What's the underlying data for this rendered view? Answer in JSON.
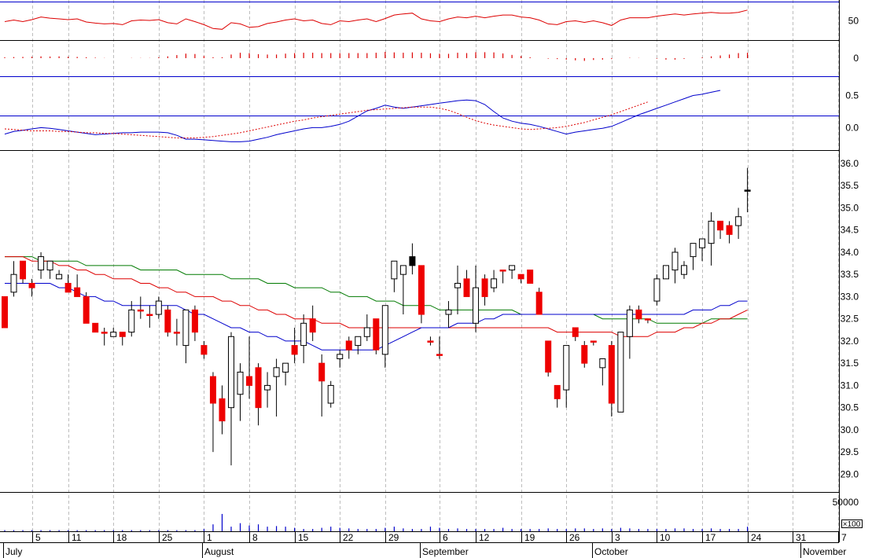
{
  "chart_data": {
    "type": "candlestick",
    "x_tick_labels": [
      {
        "label": "5",
        "date": "2012-07-05"
      },
      {
        "label": "11",
        "date": "2012-07-11"
      },
      {
        "label": "18",
        "date": "2012-07-18"
      },
      {
        "label": "25",
        "date": "2012-07-25"
      },
      {
        "label": "1",
        "date": "2012-08-01"
      },
      {
        "label": "8",
        "date": "2012-08-08"
      },
      {
        "label": "15",
        "date": "2012-08-15"
      },
      {
        "label": "22",
        "date": "2012-08-22"
      },
      {
        "label": "29",
        "date": "2012-08-29"
      },
      {
        "label": "6",
        "date": "2012-09-06"
      },
      {
        "label": "12",
        "date": "2012-09-12"
      },
      {
        "label": "19",
        "date": "2012-09-19"
      },
      {
        "label": "26",
        "date": "2012-09-26"
      },
      {
        "label": "3",
        "date": "2012-10-03"
      },
      {
        "label": "10",
        "date": "2012-10-10"
      },
      {
        "label": "17",
        "date": "2012-10-17"
      },
      {
        "label": "24",
        "date": "2012-10-24"
      },
      {
        "label": "31",
        "date": "2012-10-31"
      },
      {
        "label": "7",
        "date": "2012-11-07"
      }
    ],
    "month_labels": [
      "July",
      "August",
      "September",
      "October",
      "November"
    ],
    "panels": {
      "rsi": {
        "ticks": [
          50
        ],
        "ylim": [
          0,
          100
        ]
      },
      "macd_hist": {
        "ticks": [
          0
        ],
        "ylim": [
          -1,
          1
        ]
      },
      "macd": {
        "ticks": [
          0.5,
          0.0
        ],
        "ylim": [
          -0.35,
          0.8
        ]
      },
      "price": {
        "ticks": [
          36.0,
          35.5,
          35.0,
          34.5,
          34.0,
          33.5,
          33.0,
          32.5,
          32.0,
          31.5,
          31.0,
          30.5,
          30.0,
          29.5,
          29.0
        ],
        "ylim": [
          28.6,
          36.3
        ]
      },
      "volume": {
        "ticks": [
          50000
        ],
        "unit": "×100",
        "ylim": [
          0,
          68000
        ]
      }
    },
    "ohlc": [
      [
        33.0,
        33.0,
        32.3,
        32.3
      ],
      [
        33.1,
        33.8,
        33.0,
        33.5
      ],
      [
        33.8,
        33.8,
        33.3,
        33.4
      ],
      [
        33.3,
        33.4,
        33.0,
        33.2
      ],
      [
        33.6,
        34.0,
        33.4,
        33.9
      ],
      [
        33.6,
        33.8,
        33.4,
        33.8
      ],
      [
        33.4,
        33.6,
        33.4,
        33.5
      ],
      [
        33.3,
        33.5,
        33.1,
        33.1
      ],
      [
        33.2,
        33.5,
        33.0,
        33.0
      ],
      [
        33.0,
        33.1,
        32.4,
        32.4
      ],
      [
        32.4,
        32.4,
        32.2,
        32.2
      ],
      [
        32.2,
        32.3,
        31.9,
        32.2
      ],
      [
        32.1,
        32.3,
        32.1,
        32.2
      ],
      [
        32.2,
        32.2,
        31.9,
        32.1
      ],
      [
        32.2,
        32.9,
        32.1,
        32.7
      ],
      [
        32.7,
        33.0,
        32.5,
        32.7
      ],
      [
        32.6,
        32.8,
        32.3,
        32.6
      ],
      [
        32.6,
        33.0,
        32.5,
        32.9
      ],
      [
        32.7,
        32.8,
        32.1,
        32.2
      ],
      [
        32.2,
        32.5,
        31.9,
        32.2
      ],
      [
        31.9,
        32.7,
        31.5,
        32.7
      ],
      [
        32.7,
        32.8,
        32.0,
        32.2
      ],
      [
        31.9,
        32.0,
        31.6,
        31.7
      ],
      [
        31.2,
        31.3,
        29.5,
        30.6
      ],
      [
        30.7,
        31.0,
        29.9,
        30.2
      ],
      [
        30.5,
        32.2,
        29.2,
        32.1
      ],
      [
        30.8,
        31.5,
        30.2,
        31.3
      ],
      [
        31.2,
        32.1,
        30.7,
        31.0
      ],
      [
        31.4,
        31.5,
        30.1,
        30.5
      ],
      [
        30.9,
        31.3,
        30.5,
        31.0
      ],
      [
        31.2,
        31.6,
        30.3,
        31.4
      ],
      [
        31.3,
        31.5,
        31.0,
        31.5
      ],
      [
        31.9,
        32.3,
        31.5,
        31.7
      ],
      [
        31.9,
        32.6,
        31.5,
        32.4
      ],
      [
        32.5,
        32.8,
        32.0,
        32.2
      ],
      [
        31.5,
        31.7,
        30.3,
        31.1
      ],
      [
        30.6,
        31.1,
        30.5,
        31.0
      ],
      [
        31.6,
        31.8,
        31.4,
        31.7
      ],
      [
        32.0,
        32.1,
        31.6,
        31.8
      ],
      [
        31.9,
        32.1,
        31.7,
        32.1
      ],
      [
        32.1,
        32.6,
        32.0,
        32.3
      ],
      [
        32.5,
        32.5,
        31.7,
        31.8
      ],
      [
        31.7,
        32.6,
        31.4,
        32.8
      ],
      [
        33.4,
        33.7,
        33.1,
        33.8
      ],
      [
        33.5,
        33.6,
        32.6,
        33.7
      ],
      [
        33.9,
        34.2,
        33.5,
        33.7
      ],
      [
        33.7,
        33.7,
        32.4,
        32.6
      ],
      [
        32.0,
        32.1,
        31.9,
        32.0
      ],
      [
        31.7,
        32.1,
        31.6,
        31.7
      ],
      [
        32.6,
        32.9,
        32.3,
        32.7
      ],
      [
        33.2,
        33.7,
        32.6,
        33.3
      ],
      [
        33.4,
        33.6,
        33.1,
        33.0
      ],
      [
        32.4,
        33.7,
        32.2,
        33.2
      ],
      [
        33.4,
        33.5,
        32.8,
        33.0
      ],
      [
        33.2,
        33.6,
        33.1,
        33.4
      ],
      [
        33.6,
        33.6,
        33.3,
        33.6
      ],
      [
        33.6,
        33.6,
        33.4,
        33.7
      ],
      [
        33.5,
        33.5,
        33.3,
        33.4
      ],
      [
        33.6,
        33.6,
        33.3,
        33.3
      ],
      [
        33.1,
        33.2,
        32.6,
        32.6
      ],
      [
        32.0,
        32.0,
        31.2,
        31.3
      ],
      [
        31.0,
        31.0,
        30.5,
        30.7
      ],
      [
        30.9,
        31.5,
        30.5,
        31.9
      ],
      [
        32.3,
        32.3,
        32.0,
        32.1
      ],
      [
        31.9,
        32.0,
        31.4,
        31.5
      ],
      [
        32.0,
        32.0,
        31.9,
        32.0
      ],
      [
        31.4,
        31.6,
        31.0,
        31.6
      ],
      [
        31.9,
        32.0,
        30.3,
        30.6
      ],
      [
        30.4,
        32.2,
        30.4,
        32.2
      ],
      [
        32.1,
        32.8,
        31.6,
        32.7
      ],
      [
        32.7,
        32.8,
        32.4,
        32.5
      ],
      [
        32.5,
        32.5,
        32.4,
        32.5
      ],
      [
        32.9,
        33.5,
        32.8,
        33.4
      ],
      [
        33.4,
        33.7,
        33.4,
        33.7
      ],
      [
        33.6,
        34.1,
        33.3,
        34.0
      ],
      [
        33.5,
        33.8,
        33.4,
        33.7
      ],
      [
        33.9,
        34.2,
        33.6,
        34.2
      ],
      [
        34.1,
        34.3,
        33.8,
        34.3
      ],
      [
        34.2,
        34.9,
        33.7,
        34.7
      ],
      [
        34.7,
        34.7,
        34.3,
        34.5
      ],
      [
        34.6,
        34.7,
        34.2,
        34.4
      ],
      [
        34.6,
        35.0,
        34.3,
        34.8
      ],
      [
        35.4,
        35.9,
        34.9,
        35.4
      ]
    ],
    "indicators": {
      "price_ma_blue": [
        33.3,
        33.3,
        33.3,
        33.3,
        33.3,
        33.3,
        33.2,
        33.2,
        33.1,
        33.0,
        33.0,
        32.9,
        32.9,
        32.8,
        32.8,
        32.8,
        32.8,
        32.8,
        32.8,
        32.8,
        32.7,
        32.6,
        32.6,
        32.5,
        32.4,
        32.3,
        32.3,
        32.2,
        32.2,
        32.1,
        32.1,
        32.0,
        32.0,
        32.0,
        31.9,
        31.8,
        31.8,
        31.8,
        31.8,
        31.8,
        31.8,
        31.8,
        31.9,
        32.0,
        32.1,
        32.2,
        32.3,
        32.3,
        32.3,
        32.3,
        32.4,
        32.4,
        32.4,
        32.5,
        32.5,
        32.6,
        32.6,
        32.6,
        32.6,
        32.6,
        32.6,
        32.6,
        32.6,
        32.6,
        32.6,
        32.6,
        32.6,
        32.6,
        32.6,
        32.6,
        32.6,
        32.6,
        32.6,
        32.6,
        32.6,
        32.6,
        32.7,
        32.7,
        32.7,
        32.8,
        32.8,
        32.9,
        32.9
      ],
      "price_ma_red": [
        33.9,
        33.9,
        33.9,
        33.8,
        33.8,
        33.8,
        33.7,
        33.7,
        33.6,
        33.6,
        33.5,
        33.5,
        33.4,
        33.4,
        33.4,
        33.3,
        33.3,
        33.2,
        33.2,
        33.1,
        33.1,
        33.0,
        33.0,
        33.0,
        32.9,
        32.9,
        32.8,
        32.8,
        32.7,
        32.7,
        32.6,
        32.6,
        32.5,
        32.5,
        32.5,
        32.4,
        32.4,
        32.4,
        32.3,
        32.3,
        32.3,
        32.3,
        32.3,
        32.3,
        32.3,
        32.3,
        32.3,
        32.3,
        32.3,
        32.3,
        32.3,
        32.3,
        32.3,
        32.3,
        32.3,
        32.3,
        32.3,
        32.3,
        32.3,
        32.3,
        32.3,
        32.2,
        32.2,
        32.2,
        32.2,
        32.2,
        32.2,
        32.2,
        32.1,
        32.1,
        32.1,
        32.1,
        32.2,
        32.2,
        32.2,
        32.3,
        32.3,
        32.4,
        32.4,
        32.5,
        32.5,
        32.6,
        32.7
      ],
      "price_ma_green": [
        33.9,
        33.9,
        33.9,
        33.9,
        33.8,
        33.8,
        33.8,
        33.8,
        33.8,
        33.7,
        33.7,
        33.7,
        33.7,
        33.7,
        33.7,
        33.6,
        33.6,
        33.6,
        33.6,
        33.6,
        33.5,
        33.5,
        33.5,
        33.5,
        33.5,
        33.4,
        33.4,
        33.4,
        33.4,
        33.3,
        33.3,
        33.3,
        33.2,
        33.2,
        33.2,
        33.2,
        33.1,
        33.1,
        33.0,
        33.0,
        33.0,
        32.9,
        32.9,
        32.9,
        32.8,
        32.8,
        32.8,
        32.8,
        32.7,
        32.7,
        32.7,
        32.7,
        32.7,
        32.7,
        32.7,
        32.7,
        32.7,
        32.6,
        32.6,
        32.6,
        32.6,
        32.6,
        32.6,
        32.6,
        32.6,
        32.6,
        32.5,
        32.5,
        32.5,
        32.5,
        32.5,
        32.5,
        32.4,
        32.4,
        32.4,
        32.4,
        32.4,
        32.4,
        32.5,
        32.5,
        32.5,
        32.5,
        32.5
      ],
      "rsi": [
        48,
        52,
        48,
        53,
        60,
        57,
        55,
        53,
        55,
        47,
        44,
        42,
        43,
        40,
        50,
        52,
        51,
        53,
        45,
        42,
        55,
        48,
        40,
        30,
        28,
        45,
        42,
        33,
        35,
        43,
        47,
        52,
        55,
        50,
        52,
        43,
        40,
        50,
        48,
        52,
        55,
        48,
        56,
        65,
        68,
        70,
        55,
        50,
        48,
        55,
        60,
        58,
        62,
        58,
        62,
        65,
        65,
        60,
        58,
        52,
        42,
        40,
        48,
        50,
        46,
        50,
        45,
        38,
        52,
        58,
        58,
        58,
        62,
        65,
        68,
        65,
        68,
        70,
        72,
        70,
        70,
        72,
        78
      ],
      "macd_hist": [
        0.05,
        0.06,
        0.07,
        0.08,
        0.1,
        0.09,
        0.1,
        0.08,
        0.07,
        0.05,
        0.03,
        0.01,
        0.0,
        0.0,
        0.01,
        0.01,
        0.01,
        0.05,
        0.1,
        0.17,
        0.25,
        0.23,
        0.12,
        0.05,
        0.05,
        0.2,
        0.3,
        0.28,
        0.22,
        0.2,
        0.2,
        0.25,
        0.28,
        0.3,
        0.3,
        0.28,
        0.28,
        0.28,
        0.28,
        0.28,
        0.28,
        0.3,
        0.35,
        0.32,
        0.3,
        0.32,
        0.3,
        0.27,
        0.25,
        0.24,
        0.3,
        0.28,
        0.33,
        0.33,
        0.32,
        0.26,
        0.18,
        0.12,
        0.05,
        0.0,
        -0.03,
        -0.05,
        -0.08,
        -0.12,
        -0.15,
        -0.1,
        -0.08,
        -0.05,
        0.0,
        0.02,
        0.01,
        0.0,
        -0.03,
        -0.08,
        -0.08,
        -0.04,
        0.0,
        0.04,
        0.1,
        0.15,
        0.2,
        0.28,
        0.3
      ],
      "macd": [
        -0.1,
        -0.06,
        -0.04,
        -0.02,
        0.0,
        -0.01,
        -0.03,
        -0.05,
        -0.07,
        -0.09,
        -0.11,
        -0.1,
        -0.09,
        -0.08,
        -0.08,
        -0.07,
        -0.07,
        -0.07,
        -0.08,
        -0.12,
        -0.18,
        -0.18,
        -0.19,
        -0.2,
        -0.21,
        -0.22,
        -0.22,
        -0.21,
        -0.18,
        -0.15,
        -0.11,
        -0.08,
        -0.05,
        -0.02,
        0.0,
        0.0,
        0.02,
        0.05,
        0.1,
        0.18,
        0.26,
        0.3,
        0.35,
        0.32,
        0.3,
        0.32,
        0.34,
        0.36,
        0.38,
        0.4,
        0.42,
        0.43,
        0.42,
        0.36,
        0.25,
        0.15,
        0.1,
        0.07,
        0.05,
        0.02,
        -0.02,
        -0.06,
        -0.1,
        -0.07,
        -0.05,
        -0.03,
        -0.01,
        0.02,
        0.08,
        0.14,
        0.2,
        0.25,
        0.3,
        0.35,
        0.4,
        0.45,
        0.5,
        0.52,
        0.55,
        0.58
      ],
      "macd_signal": [
        -0.02,
        -0.03,
        -0.04,
        -0.05,
        -0.05,
        -0.05,
        -0.06,
        -0.06,
        -0.07,
        -0.08,
        -0.08,
        -0.09,
        -0.09,
        -0.1,
        -0.11,
        -0.12,
        -0.13,
        -0.14,
        -0.15,
        -0.16,
        -0.16,
        -0.16,
        -0.15,
        -0.14,
        -0.12,
        -0.1,
        -0.08,
        -0.05,
        -0.02,
        0.01,
        0.04,
        0.07,
        0.1,
        0.12,
        0.15,
        0.17,
        0.19,
        0.21,
        0.23,
        0.25,
        0.27,
        0.28,
        0.29,
        0.3,
        0.31,
        0.32,
        0.32,
        0.32,
        0.3,
        0.27,
        0.22,
        0.16,
        0.11,
        0.07,
        0.04,
        0.02,
        0.0,
        -0.02,
        -0.03,
        -0.02,
        -0.01,
        0.0,
        0.02,
        0.05,
        0.08,
        0.12,
        0.16,
        0.2,
        0.25,
        0.3,
        0.35,
        0.4
      ]
    },
    "volume": [
      2000,
      2000,
      2000,
      2000,
      2000,
      2000,
      2000,
      2000,
      2000,
      2000,
      2000,
      2000,
      2000,
      2000,
      2000,
      2000,
      2000,
      2000,
      2000,
      2000,
      2000,
      2000,
      4000,
      12000,
      30000,
      8000,
      14000,
      10000,
      12000,
      8000,
      9000,
      8000,
      6000,
      4000,
      4000,
      6000,
      8000,
      6000,
      5000,
      4000,
      4000,
      4000,
      6000,
      8000,
      5000,
      4000,
      4000,
      8000,
      6000,
      4000,
      5000,
      4000,
      4000,
      4000,
      4000,
      6000,
      4000,
      4000,
      4000,
      4000,
      5000,
      4000,
      4000,
      5000,
      5000,
      4000,
      5000,
      4000,
      6000,
      5000,
      4000,
      4000,
      4000,
      4000,
      5000,
      5000,
      4000,
      4000,
      5000,
      4000,
      4000,
      4000,
      8000
    ]
  }
}
